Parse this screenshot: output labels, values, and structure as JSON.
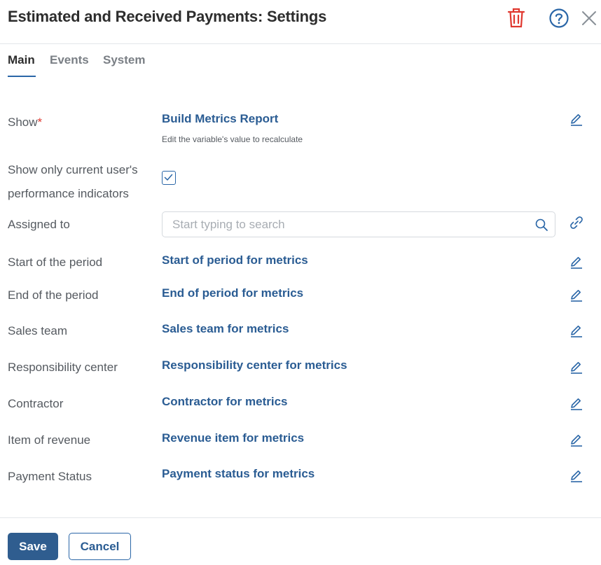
{
  "header": {
    "title": "Estimated and Received Payments: Settings",
    "icons": [
      "trash-icon",
      "help-icon",
      "close-icon"
    ],
    "trash_color": "#e0382f",
    "help_color": "#2a66a7"
  },
  "tabs": [
    {
      "label": "Main",
      "active": true
    },
    {
      "label": "Events",
      "active": false
    },
    {
      "label": "System",
      "active": false
    }
  ],
  "form": {
    "show": {
      "label": "Show",
      "required_mark": "*",
      "value": "Build Metrics Report",
      "hint": "Edit the variable's value to recalculate"
    },
    "current_user": {
      "label_line1": "Show only current user's",
      "label_line2": "performance indicators",
      "checked": true
    },
    "assigned_to": {
      "label": "Assigned to",
      "placeholder": "Start typing to search",
      "value": ""
    },
    "start_period": {
      "label": "Start of the period",
      "value": "Start of period for metrics"
    },
    "end_period": {
      "label": "End of the period",
      "value": "End of period for metrics"
    },
    "sales_team": {
      "label": "Sales team",
      "value": "Sales team for metrics"
    },
    "responsibility_center": {
      "label": "Responsibility center",
      "value": "Responsibility center for metrics"
    },
    "contractor": {
      "label": "Contractor",
      "value": "Contractor for metrics"
    },
    "item_of_revenue": {
      "label": "Item of revenue",
      "value": "Revenue item for metrics"
    },
    "payment_status": {
      "label": "Payment Status",
      "value": "Payment status for metrics"
    }
  },
  "footer": {
    "save_label": "Save",
    "cancel_label": "Cancel"
  },
  "colors": {
    "accent": "#2a66a7",
    "link": "#2a5c93",
    "primary_button": "#2f5d8f",
    "required": "#e0382f"
  }
}
